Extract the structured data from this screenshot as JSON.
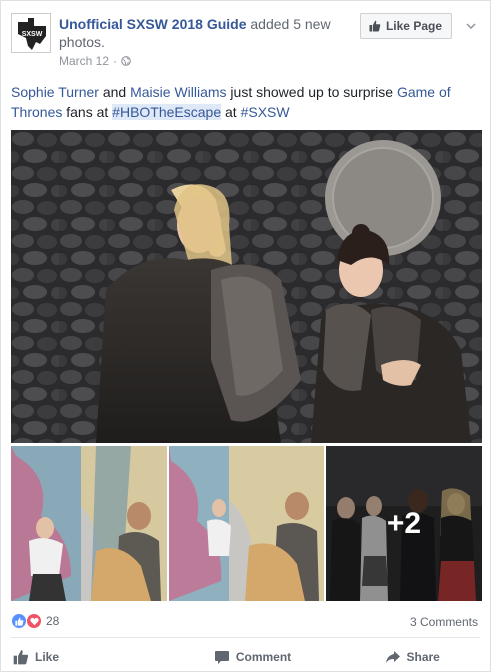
{
  "header": {
    "page_name": "Unofficial SXSW 2018 Guide",
    "action_text": " added 5 new photos.",
    "date": "March 12",
    "separator": "·",
    "avatar_text": "SXSW",
    "like_page_label": "Like Page"
  },
  "post": {
    "name1": "Sophie Turner",
    "and": " and ",
    "name2": "Maisie Williams",
    "mid": " just showed up to surprise ",
    "show": "Game of Thrones",
    "fans_at": " fans at ",
    "hashtag1": "#HBOTheEscape",
    "at": " at ",
    "hashtag2": "#SXSW"
  },
  "photos": {
    "more_count": "+2"
  },
  "stats": {
    "reaction_count": "28",
    "comments": "3 Comments"
  },
  "actions": {
    "like": "Like",
    "comment": "Comment",
    "share": "Share"
  },
  "colors": {
    "link": "#365899",
    "hashtag_bg": "#dfe8f7",
    "like_reaction": "#5890ff",
    "love_reaction": "#f25268"
  }
}
